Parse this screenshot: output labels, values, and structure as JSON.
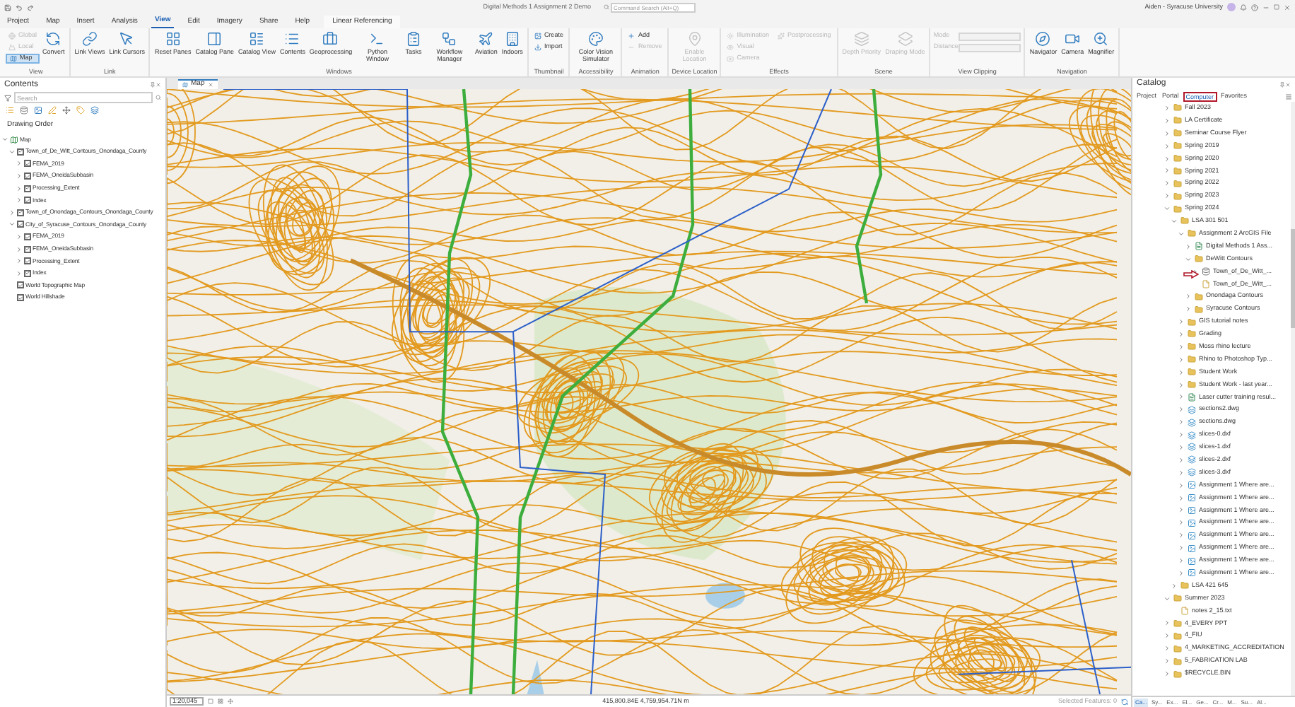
{
  "title_bar": {
    "title": "Digital Methods 1 Assignment 2 Demo",
    "search_placeholder": "Command Search (Alt+Q)",
    "user": "Aiden - Syracuse University"
  },
  "ribbon_tabs": [
    {
      "label": "Project",
      "selected": false
    },
    {
      "label": "Map",
      "selected": false
    },
    {
      "label": "Insert",
      "selected": false
    },
    {
      "label": "Analysis",
      "selected": false
    },
    {
      "label": "View",
      "selected": true
    },
    {
      "label": "Edit",
      "selected": false
    },
    {
      "label": "Imagery",
      "selected": false
    },
    {
      "label": "Share",
      "selected": false
    },
    {
      "label": "Help",
      "selected": false
    },
    {
      "label": "Linear Referencing",
      "selected": false
    }
  ],
  "ribbon_groups": [
    {
      "label": "View",
      "buttons": [
        {
          "kind": "small",
          "label": "Global",
          "disabled": true,
          "selected": false
        },
        {
          "kind": "small",
          "label": "Local",
          "disabled": true,
          "selected": false
        },
        {
          "kind": "small",
          "label": "Map",
          "disabled": false,
          "selected": true
        },
        {
          "kind": "large",
          "label": "Convert",
          "disabled": false
        }
      ]
    },
    {
      "label": "Link",
      "buttons": [
        {
          "kind": "large",
          "label": "Link Views",
          "disabled": false
        },
        {
          "kind": "large",
          "label": "Link Cursors",
          "disabled": false
        }
      ]
    },
    {
      "label": "Windows",
      "buttons": [
        {
          "kind": "large",
          "label": "Reset Panes",
          "disabled": false
        },
        {
          "kind": "large",
          "label": "Catalog Pane",
          "disabled": false
        },
        {
          "kind": "large",
          "label": "Catalog View",
          "disabled": false
        },
        {
          "kind": "large",
          "label": "Contents",
          "disabled": false
        },
        {
          "kind": "large",
          "label": "Geoprocessing",
          "disabled": false
        },
        {
          "kind": "large",
          "label": "Python Window",
          "disabled": false
        },
        {
          "kind": "large",
          "label": "Tasks",
          "disabled": false
        },
        {
          "kind": "large",
          "label": "Workflow Manager",
          "disabled": false
        },
        {
          "kind": "large",
          "label": "Aviation",
          "disabled": false
        },
        {
          "kind": "large",
          "label": "Indoors",
          "disabled": false
        }
      ]
    },
    {
      "label": "Thumbnail",
      "buttons": [
        {
          "kind": "small",
          "label": "Create",
          "disabled": false
        },
        {
          "kind": "small",
          "label": "Import",
          "disabled": false
        }
      ]
    },
    {
      "label": "Accessibility",
      "buttons": [
        {
          "kind": "large",
          "label": "Color Vision Simulator",
          "disabled": false
        }
      ]
    },
    {
      "label": "Animation",
      "buttons": [
        {
          "kind": "small",
          "label": "Add",
          "disabled": false
        },
        {
          "kind": "small",
          "label": "Remove",
          "disabled": true
        }
      ]
    },
    {
      "label": "Device Location",
      "buttons": [
        {
          "kind": "large",
          "label": "Enable Location",
          "disabled": true
        }
      ]
    },
    {
      "label": "Effects",
      "buttons": [
        {
          "kind": "small",
          "label": "Illumination",
          "disabled": true
        },
        {
          "kind": "small",
          "label": "Visual",
          "disabled": true
        },
        {
          "kind": "small",
          "label": "Camera",
          "disabled": true
        },
        {
          "kind": "small",
          "label": "Postprocessing",
          "disabled": true
        }
      ]
    },
    {
      "label": "Scene",
      "buttons": [
        {
          "kind": "large",
          "label": "Depth Priority",
          "disabled": true
        },
        {
          "kind": "large",
          "label": "Draping Mode",
          "disabled": true
        }
      ]
    },
    {
      "label": "View Clipping",
      "buttons": [
        {
          "kind": "field",
          "label": "Mode",
          "disabled": true
        },
        {
          "kind": "field",
          "label": "Distance",
          "disabled": true
        }
      ]
    },
    {
      "label": "Navigation",
      "buttons": [
        {
          "kind": "large",
          "label": "Navigator",
          "disabled": false
        },
        {
          "kind": "large",
          "label": "Camera",
          "disabled": false
        },
        {
          "kind": "large",
          "label": "Magnifier",
          "disabled": false
        }
      ]
    }
  ],
  "contents": {
    "title": "Contents",
    "search_placeholder": "Search",
    "heading": "Drawing Order",
    "layers": [
      {
        "label": "Map",
        "kind": "map",
        "expanded": true,
        "children": [
          {
            "label": "Town_of_De_Witt_Contours_Onondaga_County",
            "kind": "layer",
            "checked": true,
            "expanded": true,
            "children": [
              {
                "label": "FEMA_2019",
                "kind": "layer",
                "checked": true,
                "expanded": false
              },
              {
                "label": "FEMA_OneidaSubbasin",
                "kind": "layer",
                "checked": true,
                "expanded": false
              },
              {
                "label": "Processing_Extent",
                "kind": "layer",
                "checked": true,
                "expanded": false
              },
              {
                "label": "Index",
                "kind": "layer",
                "checked": true,
                "expanded": false
              }
            ]
          },
          {
            "label": "Town_of_Onondaga_Contours_Onondaga_County",
            "kind": "layer",
            "checked": true,
            "expanded": false
          },
          {
            "label": "City_of_Syracuse_Contours_Onondaga_County",
            "kind": "layer",
            "checked": true,
            "expanded": true,
            "children": [
              {
                "label": "FEMA_2019",
                "kind": "layer",
                "checked": true,
                "expanded": false
              },
              {
                "label": "FEMA_OneidaSubbasin",
                "kind": "layer",
                "checked": true,
                "expanded": false
              },
              {
                "label": "Processing_Extent",
                "kind": "layer",
                "checked": true,
                "expanded": false
              },
              {
                "label": "Index",
                "kind": "layer",
                "checked": true,
                "expanded": false
              }
            ]
          },
          {
            "label": "World Topographic Map",
            "kind": "layer",
            "checked": true
          },
          {
            "label": "World Hillshade",
            "kind": "layer",
            "checked": true
          }
        ]
      }
    ]
  },
  "map": {
    "tab": "Map",
    "scale": "1:20,045",
    "coordinates": "415,800.84E 4,759,954.71N m",
    "selected_features": "Selected Features: 0"
  },
  "catalog": {
    "title": "Catalog",
    "tabs": [
      {
        "label": "Project",
        "selected": false
      },
      {
        "label": "Portal",
        "selected": false
      },
      {
        "label": "Computer",
        "selected": true
      },
      {
        "label": "Favorites",
        "selected": false
      }
    ],
    "items": [
      {
        "label": "Fall 2023",
        "kind": "folder",
        "expanded": false
      },
      {
        "label": "LA Certificate",
        "kind": "folder",
        "expanded": false
      },
      {
        "label": "Seminar Course Flyer",
        "kind": "folder",
        "expanded": false
      },
      {
        "label": "Spring 2019",
        "kind": "folder",
        "expanded": false
      },
      {
        "label": "Spring 2020",
        "kind": "folder",
        "expanded": false
      },
      {
        "label": "Spring 2021",
        "kind": "folder",
        "expanded": false
      },
      {
        "label": "Spring 2022",
        "kind": "folder",
        "expanded": false
      },
      {
        "label": "Spring 2023",
        "kind": "folder",
        "expanded": false
      },
      {
        "label": "Spring 2024",
        "kind": "folder",
        "expanded": true,
        "children": [
          {
            "label": "LSA 301 501",
            "kind": "folder",
            "expanded": true,
            "children": [
              {
                "label": "Assignment 2 ArcGIS File",
                "kind": "folder",
                "expanded": true,
                "children": [
                  {
                    "label": "Digital Methods 1 Ass...",
                    "kind": "project",
                    "expanded": false
                  },
                  {
                    "label": "DeWitt Contours",
                    "kind": "folder",
                    "expanded": true,
                    "children": [
                      {
                        "label": "Town_of_De_Witt_...",
                        "kind": "shapefile",
                        "expanded": false
                      },
                      {
                        "label": "Town_of_De_Witt_...",
                        "kind": "file"
                      }
                    ]
                  },
                  {
                    "label": "Onondaga Contours",
                    "kind": "folder",
                    "expanded": false
                  },
                  {
                    "label": "Syracuse Contours",
                    "kind": "folder",
                    "expanded": false
                  }
                ]
              },
              {
                "label": "GIS tutorial notes",
                "kind": "folder",
                "expanded": false
              },
              {
                "label": "Grading",
                "kind": "folder",
                "expanded": false
              },
              {
                "label": "Moss rhino lecture",
                "kind": "folder",
                "expanded": false
              },
              {
                "label": "Rhino to Photoshop Typ...",
                "kind": "folder",
                "expanded": false
              },
              {
                "label": "Student Work",
                "kind": "folder",
                "expanded": false
              },
              {
                "label": "Student Work - last year...",
                "kind": "folder",
                "expanded": false
              },
              {
                "label": "Laser cutter training resul...",
                "kind": "project",
                "expanded": false
              },
              {
                "label": "sections2.dwg",
                "kind": "cad",
                "expanded": false
              },
              {
                "label": "sections.dwg",
                "kind": "cad",
                "expanded": false
              },
              {
                "label": "slices-0.dxf",
                "kind": "cad",
                "expanded": false
              },
              {
                "label": "slices-1.dxf",
                "kind": "cad",
                "expanded": false
              },
              {
                "label": "slices-2.dxf",
                "kind": "cad",
                "expanded": false
              },
              {
                "label": "slices-3.dxf",
                "kind": "cad",
                "expanded": false
              },
              {
                "label": "Assignment 1 Where are...",
                "kind": "raster",
                "expanded": false
              },
              {
                "label": "Assignment 1 Where are...",
                "kind": "raster",
                "expanded": false
              },
              {
                "label": "Assignment 1 Where are...",
                "kind": "raster",
                "expanded": false
              },
              {
                "label": "Assignment 1 Where are...",
                "kind": "raster",
                "expanded": false
              },
              {
                "label": "Assignment 1 Where are...",
                "kind": "raster",
                "expanded": false
              },
              {
                "label": "Assignment 1 Where are...",
                "kind": "raster",
                "expanded": false
              },
              {
                "label": "Assignment 1 Where are...",
                "kind": "raster",
                "expanded": false
              },
              {
                "label": "Assignment 1 Where are...",
                "kind": "raster",
                "expanded": false
              }
            ]
          },
          {
            "label": "LSA 421 645",
            "kind": "folder",
            "expanded": false
          }
        ]
      },
      {
        "label": "Summer 2023",
        "kind": "folder",
        "expanded": true,
        "children": [
          {
            "label": "notes 2_15.txt",
            "kind": "file"
          }
        ]
      },
      {
        "label": "4_EVERY PPT",
        "kind": "folder",
        "expanded": false
      },
      {
        "label": "4_FIU",
        "kind": "folder",
        "expanded": false
      },
      {
        "label": "4_MARKETING_ACCREDITATION",
        "kind": "folder",
        "expanded": false
      },
      {
        "label": "5_FABRICATION LAB",
        "kind": "folder",
        "expanded": false
      },
      {
        "label": "$RECYCLE.BIN",
        "kind": "folder",
        "expanded": false
      }
    ],
    "bottom_tabs": [
      {
        "label": "Ca...",
        "selected": true
      },
      {
        "label": "Sy...",
        "selected": false
      },
      {
        "label": "Ex...",
        "selected": false
      },
      {
        "label": "El...",
        "selected": false
      },
      {
        "label": "Ge...",
        "selected": false
      },
      {
        "label": "Cr...",
        "selected": false
      },
      {
        "label": "M...",
        "selected": false
      },
      {
        "label": "Su...",
        "selected": false
      },
      {
        "label": "Al...",
        "selected": false
      }
    ]
  }
}
